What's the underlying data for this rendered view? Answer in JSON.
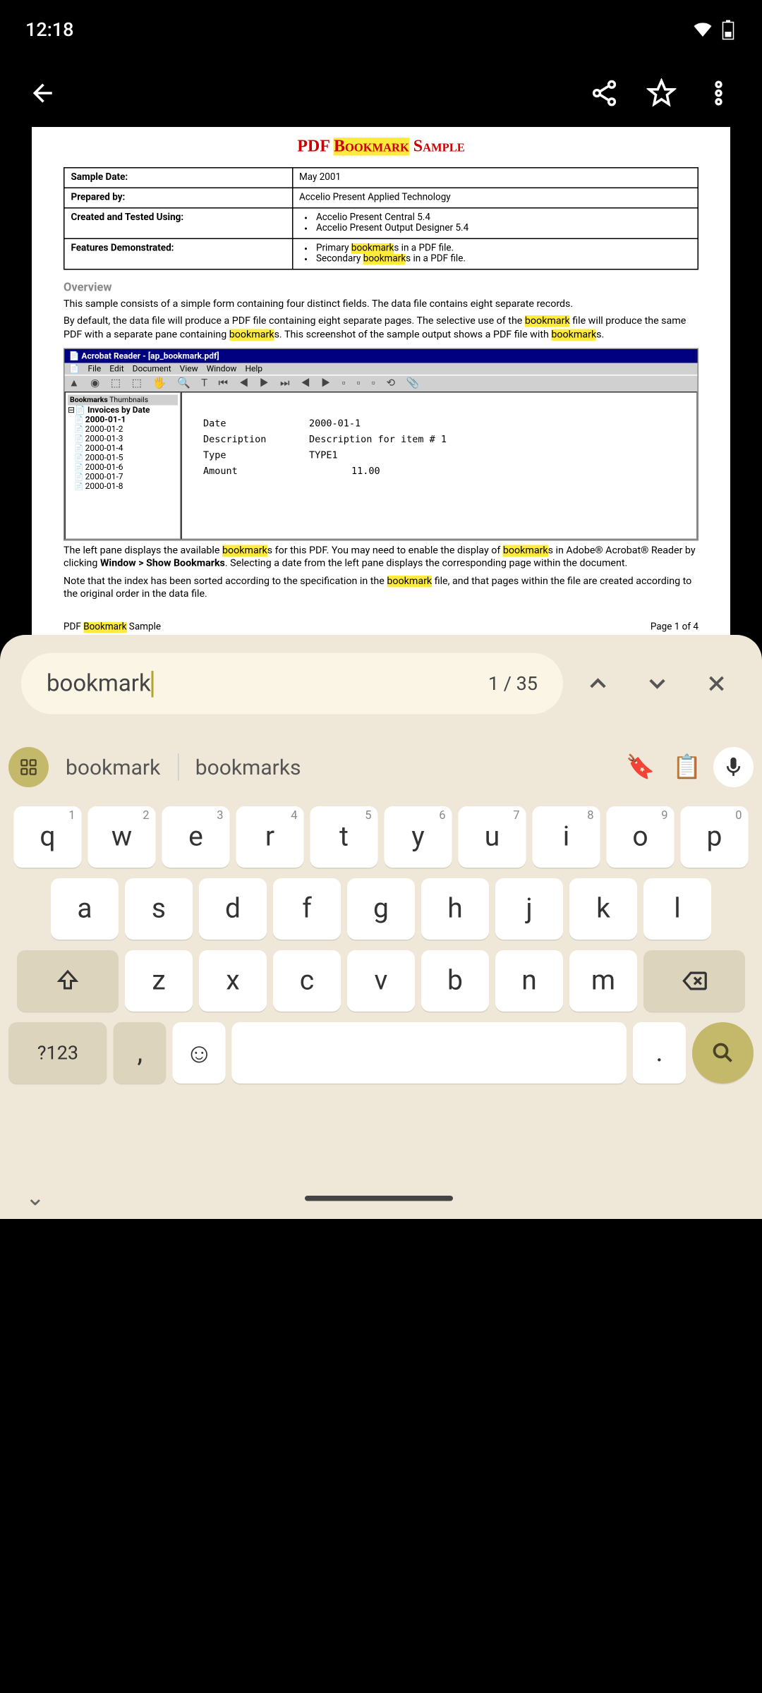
{
  "status": {
    "time": "12:18"
  },
  "doc": {
    "title_pre": "PDF ",
    "title_hl": "Bookmark",
    "title_post": " Sample",
    "table": {
      "r1l": "Sample Date:",
      "r1v": "May 2001",
      "r2l": "Prepared by:",
      "r2v": "Accelio Present Applied Technology",
      "r3l": "Created and Tested Using:",
      "r3v1": "Accelio Present Central 5.4",
      "r3v2": "Accelio Present Output Designer 5.4",
      "r4l": "Features Demonstrated:",
      "r4v1a": "Primary ",
      "r4v1b": "bookmark",
      "r4v1c": "s in a PDF file.",
      "r4v2a": "Secondary ",
      "r4v2b": "bookmark",
      "r4v2c": "s in a PDF file."
    },
    "overview_h": "Overview",
    "p1": "This sample consists of a simple form containing four distinct fields. The data file contains eight separate records.",
    "p2a": "By default, the data file will produce a PDF file containing eight separate pages. The selective use of the ",
    "p2b": "bookmark",
    "p2c": " file will produce the same PDF with a separate pane containing ",
    "p2d": "bookmark",
    "p2e": "s. This screenshot of the sample output shows a PDF file with ",
    "p2f": "bookmark",
    "p2g": "s.",
    "acrobat_title": "Acrobat Reader - [ap_bookmark.pdf]",
    "menu": {
      "file": "File",
      "edit": "Edit",
      "doc": "Document",
      "view": "View",
      "window": "Window",
      "help": "Help"
    },
    "tab_bm": "Bookmarks",
    "tab_th": "Thumbnails",
    "tree_root": "Invoices by Date",
    "tree": [
      "2000-01-1",
      "2000-01-2",
      "2000-01-3",
      "2000-01-4",
      "2000-01-5",
      "2000-01-6",
      "2000-01-7",
      "2000-01-8"
    ],
    "form": {
      "date_l": "Date",
      "date_v": "2000-01-1",
      "desc_l": "Description",
      "desc_v": "Description for item # 1",
      "type_l": "Type",
      "type_v": "TYPE1",
      "amt_l": "Amount",
      "amt_v": "11.00"
    },
    "p3a": "The left pane displays the available ",
    "p3b": "bookmark",
    "p3c": "s for this PDF. You may need to enable the display of ",
    "p3d": "bookmark",
    "p3e": "s in Adobe® Acrobat® Reader by clicking ",
    "p3f": "Window > Show Bookmarks",
    "p3g": ". Selecting a date from the left pane displays the corresponding page within the document.",
    "p4a": "Note that the index has been sorted according to the specification in the ",
    "p4b": "bookmark",
    "p4c": " file, and that pages within the file are created according to the original order in the data file.",
    "foot_l_a": "PDF ",
    "foot_l_b": "Bookmark",
    "foot_l_c": " Sample",
    "foot_r": "Page 1 of 4"
  },
  "search": {
    "query": "bookmark",
    "count": "1 / 35"
  },
  "suggestions": {
    "s1": "bookmark",
    "s2": "bookmarks"
  },
  "keys": {
    "row1": [
      "q",
      "w",
      "e",
      "r",
      "t",
      "y",
      "u",
      "i",
      "o",
      "p"
    ],
    "row1_hints": [
      "1",
      "2",
      "3",
      "4",
      "5",
      "6",
      "7",
      "8",
      "9",
      "0"
    ],
    "row2": [
      "a",
      "s",
      "d",
      "f",
      "g",
      "h",
      "j",
      "k",
      "l"
    ],
    "row3": [
      "z",
      "x",
      "c",
      "v",
      "b",
      "n",
      "m"
    ],
    "num": "?123",
    "comma": ",",
    "period": "."
  }
}
